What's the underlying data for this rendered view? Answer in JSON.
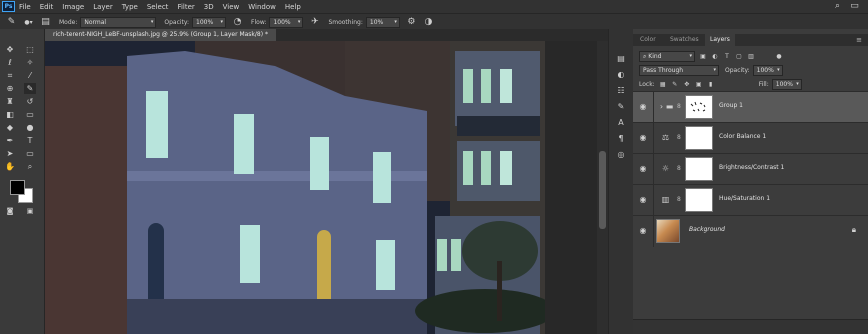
{
  "app": {
    "logo_text": "Ps"
  },
  "menu": [
    "File",
    "Edit",
    "Image",
    "Layer",
    "Type",
    "Select",
    "Filter",
    "3D",
    "View",
    "Window",
    "Help"
  ],
  "options_bar": {
    "mode_label": "Mode:",
    "mode_value": "Normal",
    "opacity_label": "Opacity:",
    "opacity_value": "100%",
    "flow_label": "Flow:",
    "flow_value": "100%",
    "smoothing_label": "Smoothing:",
    "smoothing_value": "10%"
  },
  "document_tab": {
    "title": "rich-terent-NIGH_LeBF-unsplash.jpg @ 25.9% (Group 1, Layer Mask/8) *"
  },
  "panel": {
    "tabs": [
      "Color",
      "Swatches",
      "Layers"
    ],
    "active_tab": "Layers",
    "filter_value": "Kind",
    "blend_mode": "Pass Through",
    "opacity_label": "Opacity:",
    "opacity_value": "100%",
    "lock_label": "Lock:",
    "fill_label": "Fill:",
    "fill_value": "100%"
  },
  "layers": [
    {
      "name": "Group 1",
      "type": "group",
      "selected": true
    },
    {
      "name": "Color Balance 1",
      "type": "adjustment",
      "icon": "balance-scale-icon"
    },
    {
      "name": "Brightness/Contrast 1",
      "type": "adjustment",
      "icon": "sun-icon"
    },
    {
      "name": "Hue/Saturation 1",
      "type": "adjustment",
      "icon": "hue-saturation-icon"
    },
    {
      "name": "Background",
      "type": "image",
      "locked": true
    }
  ],
  "colors": {
    "accent": "#3ea3f5",
    "foreground": "#000000",
    "background": "#ffffff"
  }
}
